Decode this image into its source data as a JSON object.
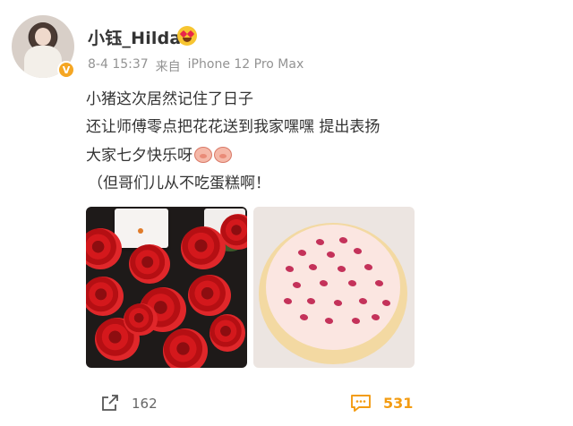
{
  "user": {
    "name": "小钰_Hilda",
    "verified_badge": "V",
    "emoji_after_name": "heart-eyes-icon"
  },
  "meta": {
    "date": "8-4 15:37",
    "source_prefix": "来自",
    "device": "iPhone 12 Pro Max"
  },
  "post": {
    "line1": "小猪这次居然记住了日子",
    "line2": "还让师傅零点把花花送到我家嘿嘿 提出表扬",
    "line3": "大家七夕快乐呀",
    "line4": "（但哥们儿从不吃蛋糕啊！"
  },
  "images": [
    {
      "name": "roses-photo"
    },
    {
      "name": "cake-photo"
    }
  ],
  "actions": {
    "share_count": "162",
    "comment_count": "531",
    "accent_color": "#f39c12"
  }
}
